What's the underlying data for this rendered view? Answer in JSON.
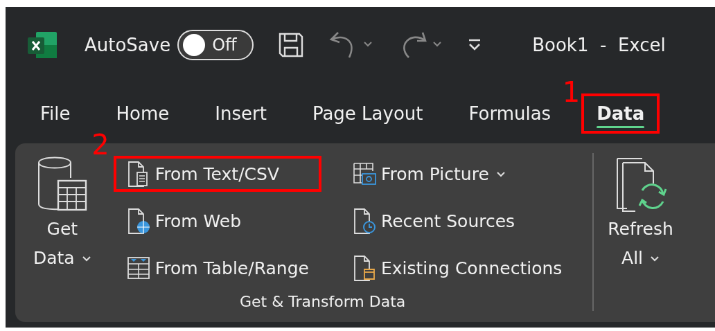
{
  "title_bar": {
    "autosave_label": "AutoSave",
    "autosave_toggle": {
      "label": "Off",
      "on": false
    },
    "title": "Book1  -  Excel"
  },
  "tabs": [
    {
      "label": "File",
      "selected": false,
      "highlighted": false
    },
    {
      "label": "Home",
      "selected": false,
      "highlighted": false
    },
    {
      "label": "Insert",
      "selected": false,
      "highlighted": false
    },
    {
      "label": "Page Layout",
      "selected": false,
      "highlighted": false
    },
    {
      "label": "Formulas",
      "selected": false,
      "highlighted": false
    },
    {
      "label": "Data",
      "selected": true,
      "highlighted": true,
      "annotation": "1"
    }
  ],
  "ribbon": {
    "group": {
      "label": "Get & Transform Data",
      "large_button": {
        "lines": [
          "Get",
          "Data"
        ],
        "dropdown": true
      },
      "columns": [
        [
          {
            "label": "From Text/CSV",
            "kind": "text",
            "dropdown": false,
            "highlighted": true,
            "annotation": "2"
          },
          {
            "label": "From Web",
            "kind": "web",
            "dropdown": false,
            "highlighted": false
          },
          {
            "label": "From Table/Range",
            "kind": "table",
            "dropdown": false,
            "highlighted": false
          }
        ],
        [
          {
            "label": "From Picture",
            "kind": "picture",
            "dropdown": true,
            "highlighted": false
          },
          {
            "label": "Recent Sources",
            "kind": "recent",
            "dropdown": false,
            "highlighted": false
          },
          {
            "label": "Existing Connections",
            "kind": "connections",
            "dropdown": false,
            "highlighted": false
          }
        ]
      ]
    },
    "refresh_button": {
      "lines": [
        "Refresh",
        "All"
      ],
      "dropdown": true
    }
  }
}
